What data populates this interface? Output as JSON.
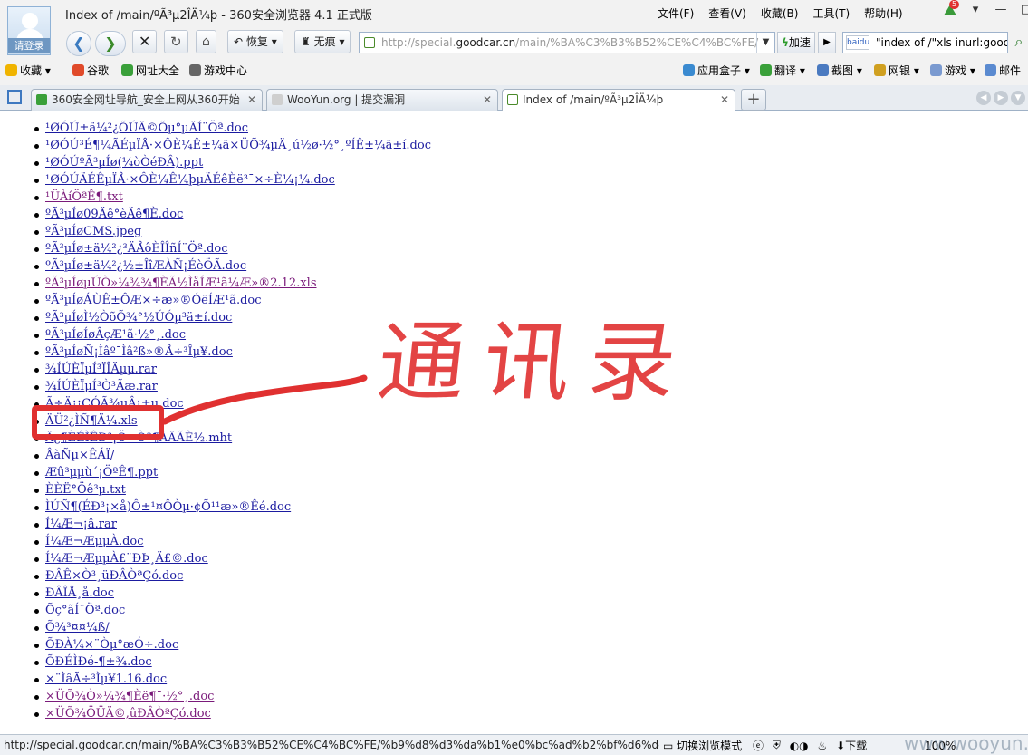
{
  "window": {
    "title": "Index of /main/ºÃ³µ2ÎÄ¼þ - 360安全浏览器 4.1 正式版",
    "login_label": "请登录"
  },
  "menu": [
    "文件(F)",
    "查看(V)",
    "收藏(B)",
    "工具(T)",
    "帮助(H)"
  ],
  "update_badge": "5",
  "toolbar": {
    "restore_label": "恢复",
    "notrace_label": "无痕",
    "speed_label": "加速",
    "url_prefix": "http://special.",
    "url_domain": "goodcar.cn",
    "url_path": "/main/%BA%C3%B3%B52%CE%C4%BC%FE/",
    "search_engine": "baidu",
    "search_query": "\"index of /\"xls inurl:goodc..."
  },
  "favorites": {
    "left": [
      "收藏",
      "谷歌",
      "网址大全",
      "游戏中心"
    ],
    "right": [
      "应用盒子",
      "翻译",
      "截图",
      "网银",
      "游戏",
      "邮件"
    ]
  },
  "tabs": [
    {
      "label": "360安全网址导航_安全上网从360开始",
      "active": false
    },
    {
      "label": "WooYun.org | 提交漏洞",
      "active": false
    },
    {
      "label": "Index of /main/ºÃ³µ2ÎÄ¼þ",
      "active": true
    }
  ],
  "listing": [
    {
      "name": "¹ØÓÚ±ä¼²¿ÕÚÄ©Õµ°µÄÍ¨Öª.doc",
      "visited": false
    },
    {
      "name": "¹ØÓÚ³É¶¼ÃÉµÏÅ·×ÔÈ¼Ê±¼ä×ÜÕ¾µÄ¸ú½ø·½°¸ºÍÊ±¼ä±í.doc",
      "visited": false
    },
    {
      "name": "¹ØÓÚºÃ³µÍø(¼òÒéÐÂ).ppt",
      "visited": false
    },
    {
      "name": "¹ØÓÚÄÉÊµÏÅ·×ÔÈ¼Ê¼þµÄÉêÈë³¯×÷È¼¡¼.doc",
      "visited": false
    },
    {
      "name": "¹ÜÀíÖªÊ¶.txt",
      "visited": true
    },
    {
      "name": "ºÃ³µÍø09Äê°èÄê¶È.doc",
      "visited": false
    },
    {
      "name": "ºÃ³µÍøCMS.jpeg",
      "visited": false
    },
    {
      "name": "ºÃ³µÍø±ä¼²¿³ÄÅôÈÎÎñÍ¨Öª.doc",
      "visited": false
    },
    {
      "name": "ºÃ³µÍø±ä¼²¿½±ÎîÆÀÑ¡ÉèÖÃ.doc",
      "visited": false
    },
    {
      "name": "ºÃ³µÍøµÚÒ»¼¾¾¶ÈÃ½ÌåÍÆ¹ã¼Æ»®2.12.xls",
      "visited": true
    },
    {
      "name": "ºÃ³µÍøÁÙÊ±ÔÆ×÷æ»®ÓëÍÆ¹ã.doc",
      "visited": false
    },
    {
      "name": "ºÃ³µÍøÌ½ÒõÕ¾°½ÚÓµ³ä±í.doc",
      "visited": false
    },
    {
      "name": "ºÃ³µÍøÍøÂçÆ¹ã·½°¸.doc",
      "visited": false
    },
    {
      "name": "ºÃ³µÍøÑ¡Ìâº¯Ìâ²ß»®Å÷³Îµ¥.doc",
      "visited": false
    },
    {
      "name": "¾ÍÚÈÏµÍ³ÏÎÄµµ.rar",
      "visited": false
    },
    {
      "name": "¾ÍÚÈÏµÍ³Ò³Ãæ.rar",
      "visited": false
    },
    {
      "name": "Ã÷Ä¡¡ÇÓÃ¾µÂ¡±µ.doc",
      "visited": false
    },
    {
      "name": "ÄÜ²¿ÌÑ¶Ä¼.xls",
      "visited": false
    },
    {
      "name": "Ä¿¶ÈÉÌÊÐ³¡Ö÷Òª¶ÀÄÃÈ½.mht",
      "visited": false
    },
    {
      "name": "ÂàÑµ×ÊÁÏ/",
      "visited": false
    },
    {
      "name": "Æû³µµù´¡ÖªÊ¶.ppt",
      "visited": false
    },
    {
      "name": "ÈÈË°Öê³µ.txt",
      "visited": false
    },
    {
      "name": "ÌÚÑ¶(ÉÐ³¡×å)Ô±¹¤Ô­Òµ·¢Õ¹¹æ»®Êé.doc",
      "visited": false
    },
    {
      "name": "Í¼Æ¬¡â.rar",
      "visited": false
    },
    {
      "name": "Í¼Æ¬ÆµµÀ.doc",
      "visited": false
    },
    {
      "name": "Í¼Æ¬ÆµµÀ£¨ÐÞ¸Ä£©.doc",
      "visited": false
    },
    {
      "name": "ÐÂÊ×Ò³¸üÐÂÒªÇó.doc",
      "visited": false
    },
    {
      "name": "ÐÂÎÅ¸å.doc",
      "visited": false
    },
    {
      "name": "Õç°ãÍ¨Öª.doc",
      "visited": false
    },
    {
      "name": "Õ¾³¤¤¼ß/",
      "visited": false
    },
    {
      "name": "ÕÐÀ¼×¨Òµ°æÓ÷.doc",
      "visited": false
    },
    {
      "name": "ÕÐÉÌÐé-¶±¾.doc",
      "visited": false
    },
    {
      "name": "×¨ÌâÃ÷³Ìµ¥1.16.doc",
      "visited": false
    },
    {
      "name": "×ÜÕ¾Ò»¼¾¶Èë¶¯·½°¸.doc",
      "visited": true
    },
    {
      "name": "×ÜÕ¾ÖÜÄ©,ûÐÂÒªÇó.doc",
      "visited": true
    }
  ],
  "annotation": {
    "handwriting": "通讯录",
    "color": "#e03030"
  },
  "status": {
    "url": "http://special.goodcar.cn/main/%BA%C3%B3%B52%CE%C4%BC%FE/%b9%d8%d3%da%b1%e0%bc%ad%b2%bf%d6%dc%...",
    "switch_mode": "切换浏览模式",
    "download": "下载",
    "zoom": "100%"
  },
  "watermark": "www.wooyun.org"
}
